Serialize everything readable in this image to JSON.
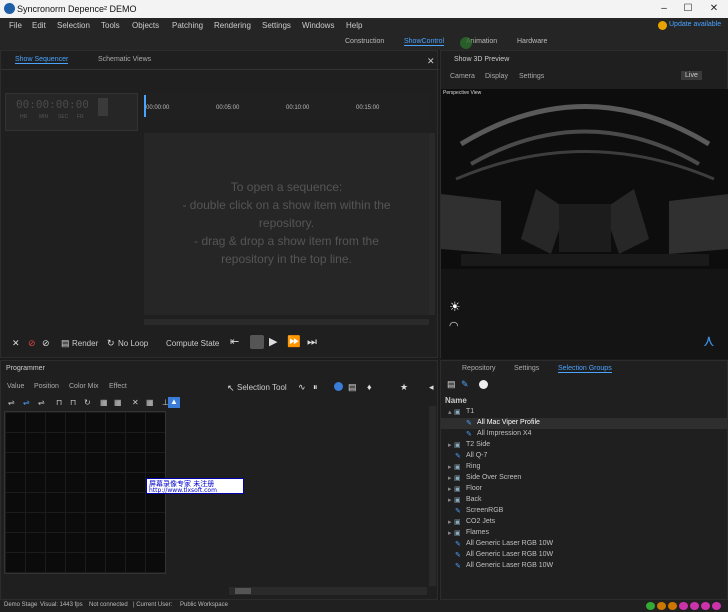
{
  "window": {
    "title": "Syncronorm Depence² DEMO",
    "minimize": "–",
    "maximize": "☐",
    "close": "✕"
  },
  "menu": [
    "File",
    "Edit",
    "Selection",
    "Tools",
    "Objects",
    "Patching",
    "Rendering",
    "Settings",
    "Windows",
    "Help"
  ],
  "update": "Update available",
  "modes": [
    "Construction",
    "ShowControl",
    "Animation",
    "Hardware"
  ],
  "sequencer": {
    "tab1": "Show Sequencer",
    "tab2": "Schematic Views",
    "close": "✕",
    "timecode": "00:00:00:00",
    "tc_units": [
      "HR",
      "MIN",
      "SEC",
      "FR"
    ],
    "ruler": [
      "00:00:00",
      "00:05:00",
      "00:10:00",
      "00:15:00"
    ],
    "message": [
      "To open a sequence:",
      "- double click on a show item within the",
      "repository.",
      "- drag & drop a show item from the",
      "repository in the top line."
    ],
    "toolbar": {
      "render": "Render",
      "noloop": "No Loop",
      "compute": "Compute State"
    }
  },
  "preview": {
    "title": "Show 3D Preview",
    "tabs": [
      "Camera",
      "Display",
      "Settings"
    ],
    "live": "Live",
    "view": "Perspective View"
  },
  "programmer": {
    "title": "Programmer",
    "tabs": [
      "Value",
      "Position",
      "Color Mix",
      "Effect"
    ],
    "selection_tool": "Selection Tool",
    "overlay1": "屏幕录像专家      未注册",
    "overlay2": "http://www.tlxsoft.com"
  },
  "repository": {
    "tabs": [
      "Repository",
      "Settings",
      "Selection Groups"
    ],
    "header": "Name",
    "items": [
      {
        "label": "T1",
        "type": "folder",
        "level": 0,
        "expanded": true
      },
      {
        "label": "All Mac Viper Profile",
        "type": "group",
        "level": 1,
        "selected": true
      },
      {
        "label": "All Impression X4",
        "type": "group",
        "level": 1
      },
      {
        "label": "T2 Side",
        "type": "folder",
        "level": 0
      },
      {
        "label": "All Q-7",
        "type": "group",
        "level": 0
      },
      {
        "label": "Ring",
        "type": "folder",
        "level": 0
      },
      {
        "label": "Side Over Screen",
        "type": "folder",
        "level": 0
      },
      {
        "label": "Floor",
        "type": "folder",
        "level": 0
      },
      {
        "label": "Back",
        "type": "folder",
        "level": 0
      },
      {
        "label": "ScreenRGB",
        "type": "group",
        "level": 0
      },
      {
        "label": "CO2 Jets",
        "type": "folder",
        "level": 0
      },
      {
        "label": "Flames",
        "type": "folder",
        "level": 0
      },
      {
        "label": "All Generic Laser RGB 10W",
        "type": "group",
        "level": 0
      },
      {
        "label": "All Generic Laser RGB 10W",
        "type": "group",
        "level": 0
      },
      {
        "label": "All Generic Laser RGB 10W",
        "type": "group",
        "level": 0
      }
    ]
  },
  "status": {
    "stage": "Demo Stage",
    "visual": "Visual: 1443 fps",
    "conn": "Not connected",
    "user": "| Current User:",
    "ws": "Public Workspace"
  },
  "colors": {
    "accent": "#4aa3ff",
    "panel": "#1f1f1f",
    "bg": "#1b1b1b"
  }
}
